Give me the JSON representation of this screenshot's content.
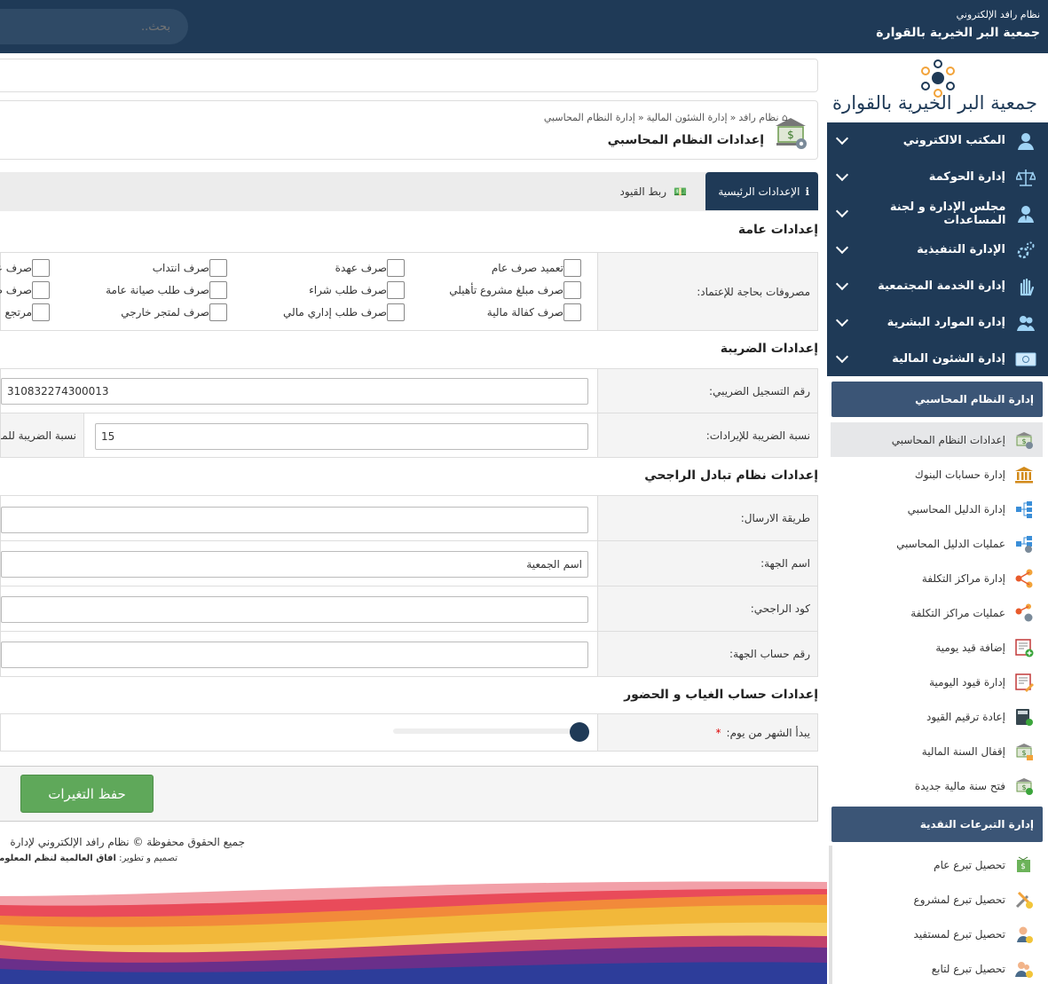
{
  "header": {
    "system_name": "نظام رافد الإلكتروني",
    "org_name": "جمعية البر الخيرية بالقوارة",
    "search_placeholder": "بحث.."
  },
  "sidebar": {
    "logo_text": "جمعية البر الخيرية بالقوارة",
    "main_menu": [
      {
        "label": "المكتب الالكتروني",
        "icon": "user-icon"
      },
      {
        "label": "إدارة الحوكمة",
        "icon": "scales-icon"
      },
      {
        "label": "مجلس الإدارة و لجنة المساعدات",
        "icon": "manager-icon"
      },
      {
        "label": "الإدارة التنفيذية",
        "icon": "gears-icon"
      },
      {
        "label": "إدارة الخدمة المجتمعية",
        "icon": "hand-icon"
      },
      {
        "label": "إدارة الموارد البشرية",
        "icon": "people-icon"
      },
      {
        "label": "إدارة الشئون المالية",
        "icon": "money-icon"
      }
    ],
    "accounting_title": "إدارة النظام المحاسبي",
    "accounting_items": [
      {
        "label": "إعدادات النظام المحاسبي",
        "icon": "bank-settings-icon"
      },
      {
        "label": "إدارة حسابات البنوك",
        "icon": "bank-icon"
      },
      {
        "label": "إدارة الدليل المحاسبي",
        "icon": "tree-icon"
      },
      {
        "label": "عمليات الدليل المحاسبي",
        "icon": "tree-gear-icon"
      },
      {
        "label": "إدارة مراكز التكلفة",
        "icon": "share-icon"
      },
      {
        "label": "عمليات مراكز التكلفة",
        "icon": "share-gear-icon"
      },
      {
        "label": "إضافة قيد يومية",
        "icon": "ledger-add-icon"
      },
      {
        "label": "إدارة قيود اليومية",
        "icon": "ledger-edit-icon"
      },
      {
        "label": "إعادة ترقيم القيود",
        "icon": "calculator-icon"
      },
      {
        "label": "إقفال السنة المالية",
        "icon": "bank-lock-icon"
      },
      {
        "label": "فتح سنة مالية جديدة",
        "icon": "bank-add-icon"
      }
    ],
    "donations_title": "إدارة التبرعات النقدية",
    "donations_items": [
      {
        "label": "تحصيل تبرع عام",
        "icon": "cash-icon"
      },
      {
        "label": "تحصيل تبرع لمشروع",
        "icon": "tools-icon"
      },
      {
        "label": "تحصيل تبرع لمستفيد",
        "icon": "beneficiary-icon"
      },
      {
        "label": "تحصيل تبرع لتابع",
        "icon": "dependent-icon"
      }
    ]
  },
  "page": {
    "breadcrumb": [
      "نظام رافد",
      "إدارة الشئون المالية",
      "إدارة النظام المحاسبي"
    ],
    "title": "إعدادات النظام المحاسبي",
    "tabs": [
      "الإعدادات الرئيسية",
      "ربط القيود"
    ]
  },
  "general": {
    "title": "إعدادات عامة",
    "approval_label": "مصروفات بحاجة للإعتماد:",
    "checkboxes": [
      [
        "تعميد صرف عام",
        "صرف عهدة",
        "صرف انتداب",
        "صرف عـ"
      ],
      [
        "صرف مبلغ مشروع تأهيلي",
        "صرف طلب شراء",
        "صرف طلب صيانة عامة",
        "صرف طـ"
      ],
      [
        "صرف كفالة مالية",
        "صرف طلب إداري مالي",
        "صرف لمتجر خارجي",
        "مرتجع"
      ]
    ]
  },
  "tax": {
    "title": "إعدادات الضريبة",
    "reg_label": "رقم التسجيل الضريبي:",
    "reg_value": "310832274300013",
    "revenue_label": "نسبة الضريبة للإيرادات:",
    "revenue_value": "15",
    "other_label": "نسبة الضريبة للمـ"
  },
  "rajhi": {
    "title": "إعدادات نظام تبادل الراجحي",
    "send_method_label": "طريقة الارسال:",
    "send_method_value": "",
    "entity_name_label": "اسم الجهة:",
    "entity_name_value": "اسم الجمعية",
    "rajhi_code_label": "كود الراجحي:",
    "rajhi_code_value": "",
    "entity_account_label": "رقم حساب الجهة:",
    "entity_account_value": ""
  },
  "attendance": {
    "title": "إعدادات حساب الغياب و الحضور",
    "month_start_label": "يبدأ الشهر من يوم:",
    "required_mark": "*",
    "month_start_value_fraction": 1.0
  },
  "actions": {
    "save": "حفظ التغيرات"
  },
  "footer": {
    "rights": "جميع الحقوق محفوظة © نظام رافد الإلكتروني لإدارة",
    "credits_prefix": "تصميم و تطوير:",
    "credits_company": "آفاق العالمية لنظم المعلومات"
  },
  "colors": {
    "primary": "#1f3a57",
    "submenu_header": "#3b5576",
    "save_button": "#5fa85a"
  }
}
